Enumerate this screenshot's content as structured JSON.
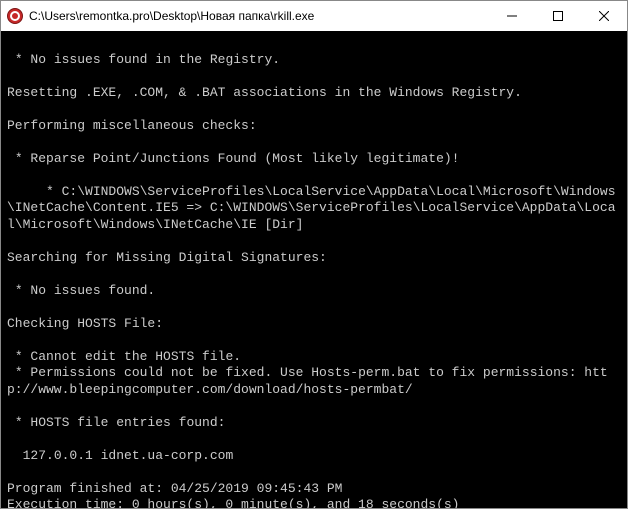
{
  "window": {
    "title": "C:\\Users\\remontka.pro\\Desktop\\Новая папка\\rkill.exe"
  },
  "console": {
    "lines": [
      "",
      " * No issues found in the Registry.",
      "",
      "Resetting .EXE, .COM, & .BAT associations in the Windows Registry.",
      "",
      "Performing miscellaneous checks:",
      "",
      " * Reparse Point/Junctions Found (Most likely legitimate)!",
      "",
      "     * C:\\WINDOWS\\ServiceProfiles\\LocalService\\AppData\\Local\\Microsoft\\Windows\\INetCache\\Content.IE5 => C:\\WINDOWS\\ServiceProfiles\\LocalService\\AppData\\Local\\Microsoft\\Windows\\INetCache\\IE [Dir]",
      "",
      "Searching for Missing Digital Signatures:",
      "",
      " * No issues found.",
      "",
      "Checking HOSTS File:",
      "",
      " * Cannot edit the HOSTS file.",
      " * Permissions could not be fixed. Use Hosts-perm.bat to fix permissions: http://www.bleepingcomputer.com/download/hosts-permbat/",
      "",
      " * HOSTS file entries found:",
      "",
      "  127.0.0.1 idnet.ua-corp.com",
      "",
      "Program finished at: 04/25/2019 09:45:43 PM",
      "Execution time: 0 hours(s), 0 minute(s), and 18 seconds(s)",
      ""
    ]
  }
}
